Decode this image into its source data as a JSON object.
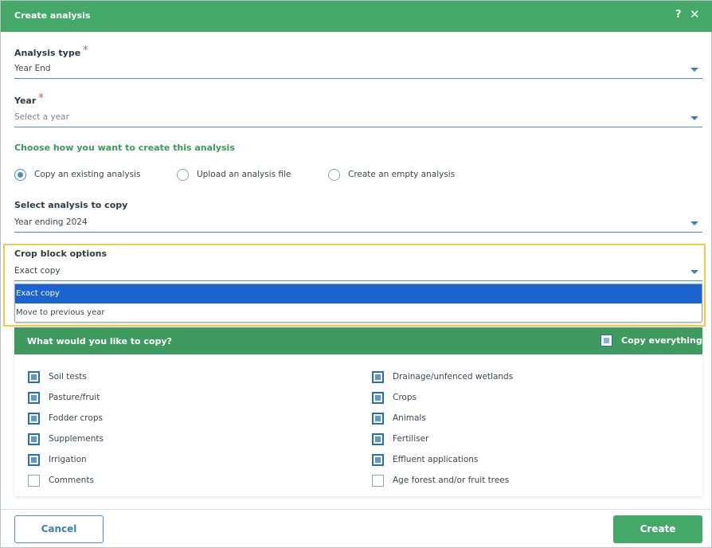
{
  "dialog": {
    "title": "Create analysis",
    "help_glyph": "?",
    "close_glyph": "✕"
  },
  "analysis_type": {
    "label": "Analysis type",
    "required_mark": "*",
    "value": "Year End"
  },
  "year": {
    "label": "Year",
    "required_mark": "*",
    "placeholder": "Select a year"
  },
  "create_method": {
    "heading": "Choose how you want to create this analysis",
    "options": [
      {
        "label": "Copy an existing analysis",
        "checked": true
      },
      {
        "label": "Upload an analysis file",
        "checked": false
      },
      {
        "label": "Create an empty analysis",
        "checked": false
      }
    ]
  },
  "analysis_to_copy": {
    "label": "Select analysis to copy",
    "value": "Year ending 2024"
  },
  "crop_block": {
    "label": "Crop block options",
    "value": "Exact copy",
    "options": [
      "Exact copy",
      "Move to previous year"
    ],
    "selected_option": "Exact copy"
  },
  "copy_panel": {
    "title": "What would you like to copy?",
    "copy_everything_label": "Copy everything",
    "left_items": [
      {
        "label": "Soil tests",
        "checked": true
      },
      {
        "label": "Pasture/fruit",
        "checked": true
      },
      {
        "label": "Fodder crops",
        "checked": true
      },
      {
        "label": "Supplements",
        "checked": true
      },
      {
        "label": "Irrigation",
        "checked": true
      },
      {
        "label": "Comments",
        "checked": false
      }
    ],
    "right_items": [
      {
        "label": "Drainage/unfenced wetlands",
        "checked": true
      },
      {
        "label": "Crops",
        "checked": true
      },
      {
        "label": "Animals",
        "checked": true
      },
      {
        "label": "Fertiliser",
        "checked": true
      },
      {
        "label": "Effluent applications",
        "checked": true
      },
      {
        "label": "Age forest and/or fruit trees",
        "checked": false
      }
    ]
  },
  "footer": {
    "cancel_label": "Cancel",
    "create_label": "Create"
  },
  "colors": {
    "header_green": "#44a869",
    "panel_green": "#3f9a5f",
    "accent_blue": "#4a90c8",
    "selected_blue": "#1a63d0",
    "highlight_yellow": "#f2c94c",
    "required_red": "#d9534f"
  }
}
